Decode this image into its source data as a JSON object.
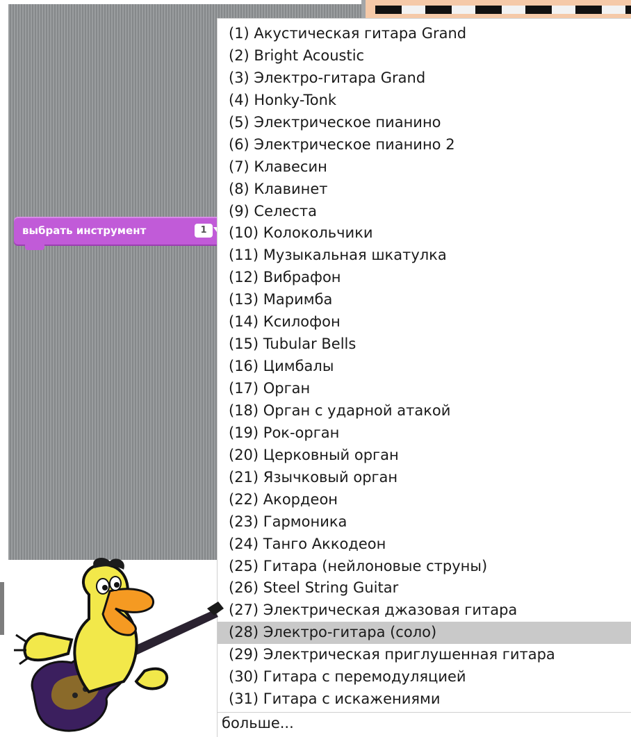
{
  "block": {
    "label": "выбрать инструмент",
    "value": "1",
    "color": "#c15bd8"
  },
  "menu": {
    "items": [
      "(1) Акустическая гитара Grand",
      "(2) Bright Acoustic",
      "(3) Электро-гитара Grand",
      "(4) Honky-Tonk",
      "(5) Электрическое пианино",
      "(6) Электрическое пианино 2",
      "(7) Клавесин",
      "(8) Клавинет",
      "(9) Селеста",
      "(10) Колокольчики",
      "(11) Музыкальная шкатулка",
      "(12) Вибрафон",
      "(13) Маримба",
      "(14) Ксилофон",
      "(15) Tubular Bells",
      "(16) Цимбалы",
      "(17) Орган",
      "(18) Орган с ударной атакой",
      "(19) Рок-орган",
      "(20) Церковный орган",
      "(21) Язычковый орган",
      "(22) Акордеон",
      "(23) Гармоника",
      "(24) Танго Аккодеон",
      "(25) Гитара (нейлоновые струны)",
      "(26) Steel String Guitar",
      "(27) Электрическая джазовая гитара",
      "(28) Электро-гитара (соло)",
      "(29) Электрическая приглушенная гитара",
      "(30) Гитара с перемодуляцией",
      "(31) Гитара с искажениями"
    ],
    "highlighted_index": 27,
    "highlight_color": "#c9c9c9",
    "more_label": "больше..."
  },
  "decor": {
    "mascot_icon": "duck-guitar-icon",
    "script_area_color": "#8f9294"
  }
}
